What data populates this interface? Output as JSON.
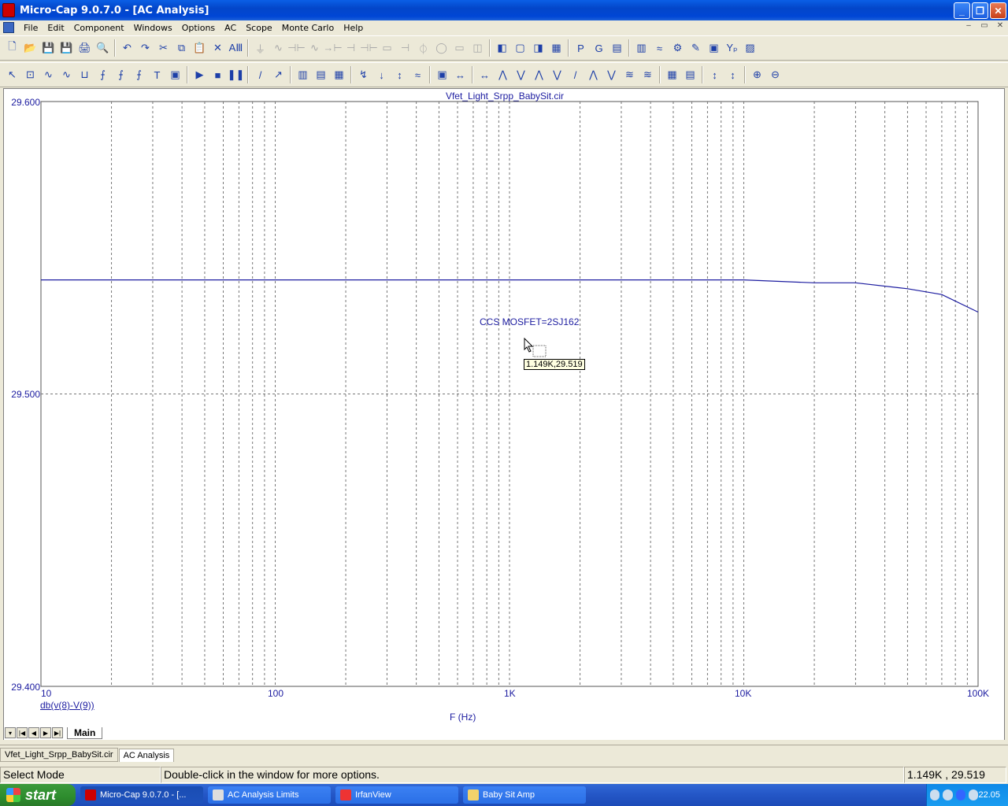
{
  "window": {
    "title": "Micro-Cap 9.0.7.0 - [AC Analysis]",
    "controls": [
      "_",
      "❐",
      "✕"
    ]
  },
  "menu": {
    "items": [
      "File",
      "Edit",
      "Component",
      "Windows",
      "Options",
      "AC",
      "Scope",
      "Monte Carlo",
      "Help"
    ],
    "mdi_controls": [
      "–",
      "▭",
      "✕"
    ]
  },
  "toolbar1": [
    "🗋",
    "📂",
    "💾",
    "💾",
    "🖨",
    "🔍",
    "↶",
    "↷",
    "✂",
    "⧉",
    "📋",
    "✕",
    "AⅢ",
    "⏚",
    "∿",
    "⊣⊢",
    "∿",
    "→⊢",
    "⊣",
    "⊣⊢",
    "▭",
    "⊣",
    "⏀",
    "◯",
    "▭",
    "◫",
    "◧",
    "▢",
    "◨",
    "▦",
    "P",
    "G",
    "▤",
    "▥",
    "≈",
    "⚙",
    "✎",
    "▣",
    "Yₚ",
    "▨"
  ],
  "toolbar2": [
    "↖",
    "⊡",
    "∿",
    "∿",
    "⊔",
    "⨍",
    "⨍",
    "⨍",
    "T",
    "▣",
    "▶",
    "■",
    "❚❚",
    "/",
    "↗",
    "▥",
    "▤",
    "▦",
    "↯",
    "↓",
    "↕",
    "≈",
    "▣",
    "↔",
    "↔",
    "⋀",
    "⋁",
    "⋀",
    "⋁",
    "/",
    "⋀",
    "⋁",
    "≋",
    "≋",
    "▦",
    "▤",
    "↕",
    "↕",
    "⊕",
    "⊖"
  ],
  "plot": {
    "title": "Vfet_Light_Srpp_BabySit.cir",
    "expression": "db(v(8)-V(9))",
    "x_axis_name": "F (Hz)",
    "annotation": "CCS MOSFET=2SJ162",
    "tooltip": "1.149K,29.519",
    "y_ticks": [
      "29.600",
      "29.500",
      "29.400"
    ],
    "x_ticks": [
      "10",
      "100",
      "1K",
      "10K",
      "100K"
    ],
    "trace_color": "#1c1ca0"
  },
  "chart_data": {
    "type": "line",
    "title": "Vfet_Light_Srpp_BabySit.cir",
    "xlabel": "F (Hz)",
    "ylabel": "db(v(8)-V(9))",
    "xscale": "log",
    "xlim": [
      10,
      100000
    ],
    "ylim": [
      29.4,
      29.6
    ],
    "grid": true,
    "series": [
      {
        "name": "db(v(8)-V(9))",
        "x": [
          10,
          100,
          1000,
          5000,
          10000,
          20000,
          30000,
          50000,
          70000,
          100000
        ],
        "y": [
          29.539,
          29.539,
          29.539,
          29.539,
          29.539,
          29.538,
          29.538,
          29.536,
          29.534,
          29.528
        ]
      }
    ]
  },
  "page_tabs": {
    "nav": [
      "▾",
      "|◀",
      "◀",
      "▶",
      "▶|"
    ],
    "active": "Main"
  },
  "doc_tabs": [
    "Vfet_Light_Srpp_BabySit.cir",
    "AC Analysis"
  ],
  "status": {
    "mode": "Select Mode",
    "hint": "Double-click in the window for more options.",
    "coords": "1.149K , 29.519"
  },
  "taskbar": {
    "start": "start",
    "tasks": [
      "Micro-Cap 9.0.7.0 - [...",
      "AC Analysis Limits",
      "IrfanView",
      "Baby Sit Amp"
    ],
    "clock": "22.05"
  }
}
